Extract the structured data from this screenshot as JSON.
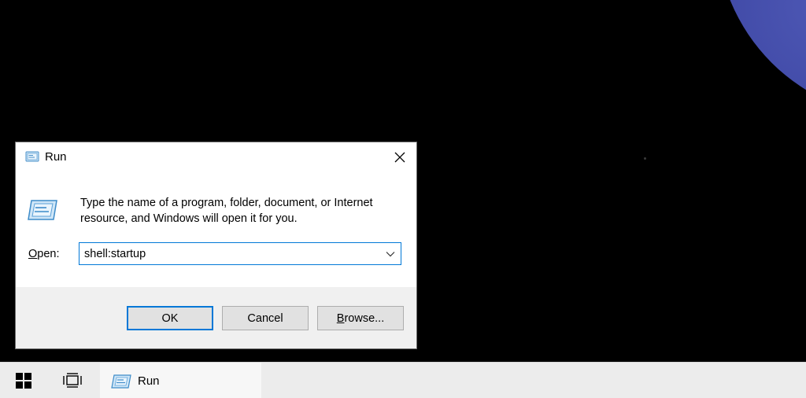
{
  "dialog": {
    "title": "Run",
    "description": "Type the name of a program, folder, document, or Internet resource, and Windows will open it for you.",
    "open_label_mnemonic": "O",
    "open_label_rest": "pen:",
    "open_value": "shell:startup",
    "ok_label": "OK",
    "cancel_label": "Cancel",
    "browse_mnemonic": "B",
    "browse_rest": "rowse...",
    "accent_color": "#0078d7"
  },
  "taskbar": {
    "run_label": "Run",
    "icons": [
      "windows-start-icon",
      "task-view-icon",
      "run-icon"
    ]
  }
}
